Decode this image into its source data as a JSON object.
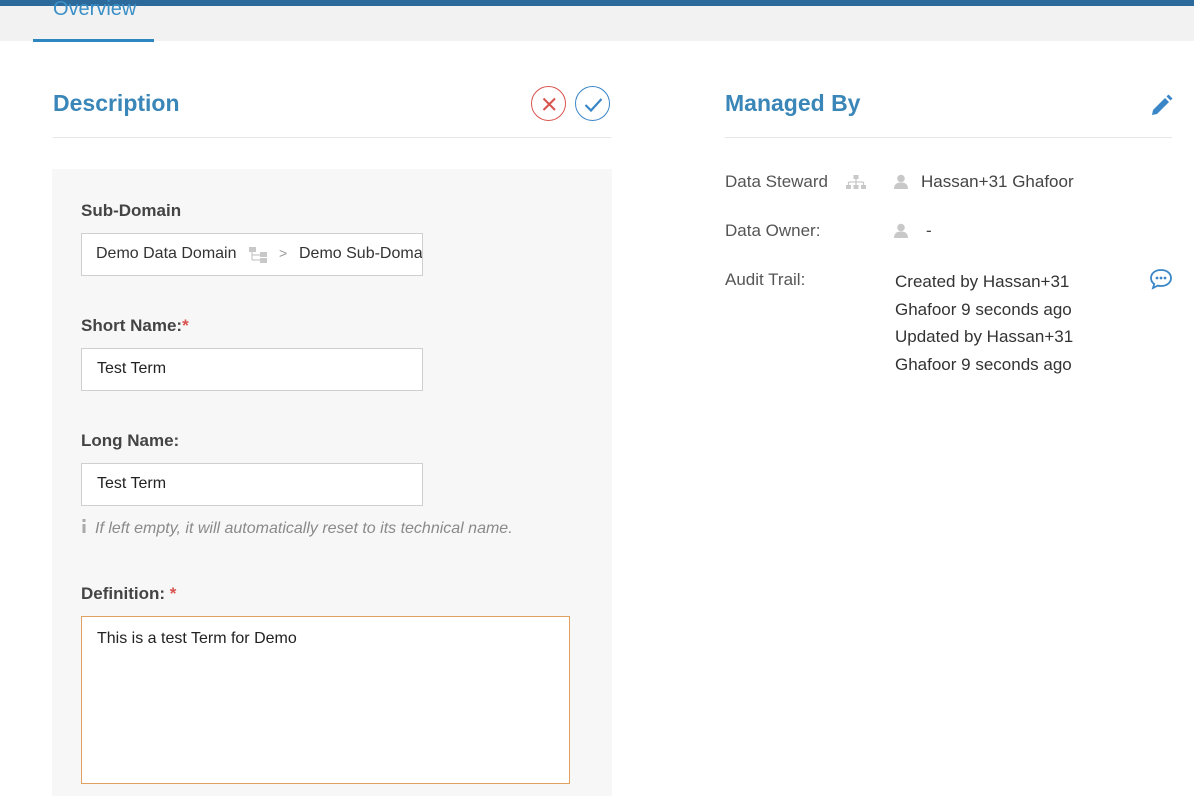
{
  "tabs": {
    "overview": "Overview"
  },
  "description": {
    "title": "Description",
    "sub_domain": {
      "label": "Sub-Domain",
      "domain": "Demo Data Domain",
      "separator": ">",
      "subdomain": "Demo Sub-Domain"
    },
    "short_name": {
      "label": "Short Name:",
      "required_mark": "*",
      "value": "Test Term"
    },
    "long_name": {
      "label": "Long Name:",
      "value": "Test Term",
      "hint": "If left empty, it will automatically reset to its technical name."
    },
    "definition": {
      "label": "Definition:",
      "required_mark": "*",
      "value": "This is a test Term for Demo"
    }
  },
  "managed_by": {
    "title": "Managed By",
    "data_steward": {
      "label": "Data Steward",
      "value": "Hassan+31 Ghafoor"
    },
    "data_owner": {
      "label": "Data Owner:",
      "value": "-"
    },
    "audit_trail": {
      "label": "Audit Trail:",
      "created": "Created by Hassan+31 Ghafoor 9 seconds ago",
      "updated": "Updated by Hassan+31 Ghafoor 9 seconds ago"
    }
  },
  "colors": {
    "accent": "#3a86b8",
    "error": "#d9534f",
    "focus_border": "#e0a060"
  }
}
